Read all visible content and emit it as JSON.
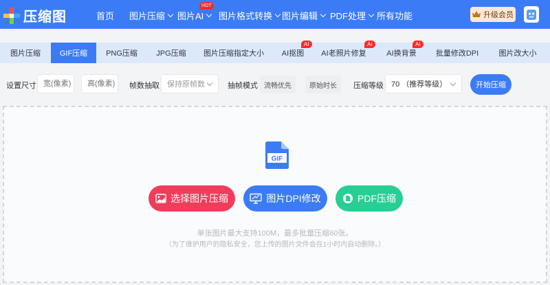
{
  "brand": {
    "name": "压缩图"
  },
  "nav": [
    {
      "label": "首页",
      "dropdown": false
    },
    {
      "label": "图片压缩",
      "dropdown": true
    },
    {
      "label": "图片AI",
      "dropdown": true,
      "badge": "HOT"
    },
    {
      "label": "图片格式转换",
      "dropdown": true
    },
    {
      "label": "图片编辑",
      "dropdown": true
    },
    {
      "label": "PDF处理",
      "dropdown": true
    },
    {
      "label": "所有功能",
      "dropdown": false
    }
  ],
  "upgrade_label": "升级会员",
  "tabs": [
    {
      "label": "图片压缩"
    },
    {
      "label": "GIF压缩",
      "active": true
    },
    {
      "label": "PNG压缩"
    },
    {
      "label": "JPG压缩"
    },
    {
      "label": "图片压缩指定大小"
    },
    {
      "label": "AI抠图",
      "badge": "AI"
    },
    {
      "label": "AI老照片修复",
      "badge": "AI"
    },
    {
      "label": "AI换背景",
      "badge": "AI"
    },
    {
      "label": "批量修改DPI"
    },
    {
      "label": "图片改大小"
    }
  ],
  "settings": {
    "size_label": "设置尺寸",
    "width_placeholder": "宽(像素)",
    "height_placeholder": "高(像素)",
    "frame_label": "帧数抽取",
    "frame_value": "保持原帧数",
    "mode_label": "抽帧模式",
    "mode_options": [
      "流畅优先",
      "原始时长"
    ],
    "level_label": "压缩等级",
    "level_value": "70 （推荐等级）",
    "start_button": "开始压缩"
  },
  "upload": {
    "file_icon_text": "GIF",
    "buttons": [
      {
        "label": "选择图片压缩",
        "icon": "image-icon",
        "color": "#ef3d5b"
      },
      {
        "label": "图片DPI修改",
        "icon": "monitor-icon",
        "color": "#3b7cf6"
      },
      {
        "label": "PDF压缩",
        "icon": "pdf-icon",
        "color": "#27cf95"
      }
    ],
    "hint_line1": "单张图片最大支持100M，最多批量压缩60张。",
    "hint_line2": "（为了维护用户的隐私安全，您上传的图片文件会在1小时内自动删除。）"
  },
  "colors": {
    "primary": "#3b7cf6",
    "tab_bar": "#dce9fb",
    "badge": "#ff2a2a"
  }
}
